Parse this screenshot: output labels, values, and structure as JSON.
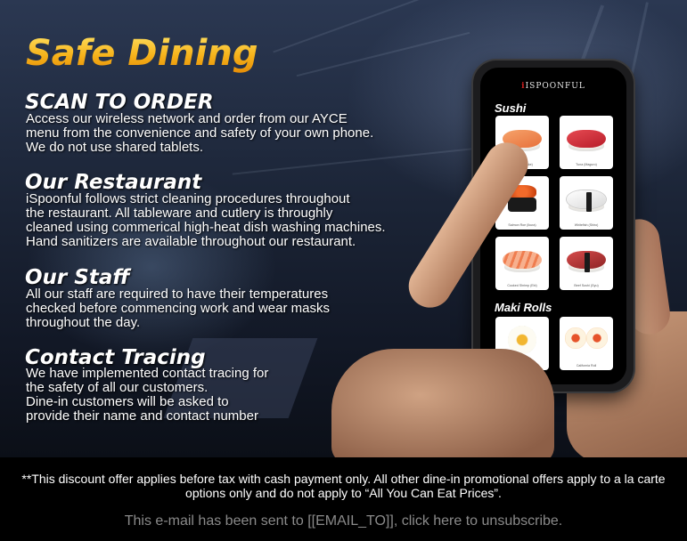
{
  "header": {
    "title": "Safe Dining"
  },
  "sections": [
    {
      "heading": "SCAN TO ORDER",
      "body": "Access our wireless network and order from our AYCE\nmenu from the convenience and safety of your own phone.\nWe do not use shared tablets."
    },
    {
      "heading": "Our Restaurant",
      "body": "iSpoonful follows strict cleaning procedures throughout\nthe restaurant. All tableware and cutlery is throughly\ncleaned using commerical high-heat dish washing machines.\nHand sanitizers are available throughout our restaurant."
    },
    {
      "heading": "Our Staff",
      "body": "All our staff are required to have their temperatures\nchecked before commencing work and wear masks\nthroughout the day."
    },
    {
      "heading": "Contact Tracing",
      "body": "We have implemented contact tracing for\nthe safety of all our customers.\nDine-in customers will be asked to\nprovide their name and contact number"
    }
  ],
  "phone": {
    "brand": "ISPOONFUL",
    "category_1": "Sushi",
    "category_2": "Maki Rolls",
    "items": [
      {
        "label": "Salmon (Sake)",
        "color": "#f08a4b"
      },
      {
        "label": "Tuna (Maguro)",
        "color": "#d8303a"
      },
      {
        "label": "Salmon Roe (Ikura)",
        "color": "#e6501c"
      },
      {
        "label": "Whitefish (Shiro)",
        "color": "#eeeeee"
      },
      {
        "label": "Cooked Shrimp (Ebi)",
        "color": "#f4a07c"
      },
      {
        "label": "Beef Sushi (Gyu)",
        "color": "#c23a3a"
      },
      {
        "label": "Mango Roll",
        "color": "#f2b630"
      },
      {
        "label": "California Roll",
        "color": "#f5c89a"
      }
    ]
  },
  "footer": {
    "disclaimer": "**This discount offer applies before tax with cash payment only. All other dine-in promotional offers apply to a la carte options only and do not apply to “All You Can Eat Prices”.",
    "unsubscribe": "This e-mail has been sent to [[EMAIL_TO]], click here to unsubscribe."
  },
  "colors": {
    "title_gold": "#f6b21a",
    "footer_bg": "#000000",
    "unsubscribe_gray": "#8a8a8a"
  }
}
